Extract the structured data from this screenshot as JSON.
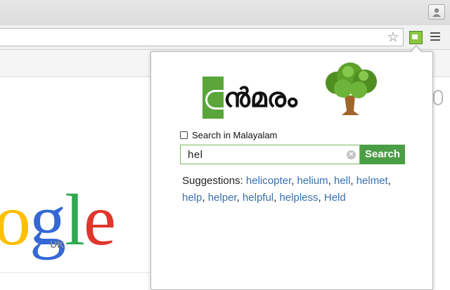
{
  "popup": {
    "brand_text": "ൻമരം",
    "checkbox_label": "Search in Malayalam",
    "checkbox_checked": false,
    "search_value": "hel",
    "search_button_label": "Search",
    "clear_glyph": "×",
    "suggestions_label": "Suggestions:",
    "suggestions": [
      "helicopter",
      "helium",
      "hell",
      "helmet",
      "help",
      "helper",
      "helpful",
      "helpless",
      "Held"
    ]
  },
  "page": {
    "logo_letters": [
      "o",
      "g",
      "l",
      "e"
    ],
    "region_label": "UK"
  },
  "browser": {
    "star_glyph": "☆"
  },
  "colors": {
    "accent_green": "#4a9e45",
    "link_blue": "#3a6fae",
    "input_border": "#7bb95b"
  }
}
